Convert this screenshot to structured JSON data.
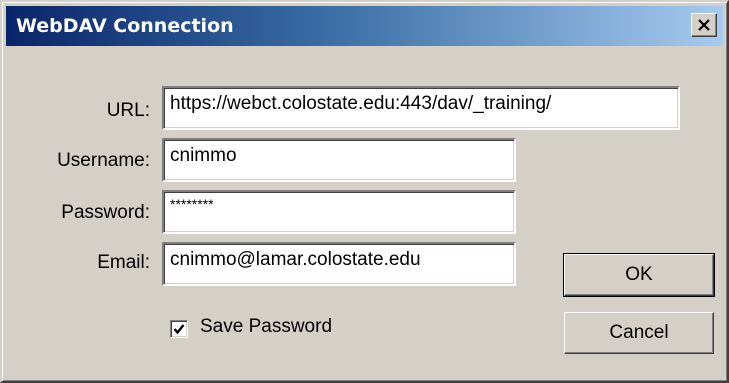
{
  "window": {
    "title": "WebDAV Connection",
    "close_icon": "close-x-icon"
  },
  "form": {
    "url_label": "URL:",
    "url_value": "https://webct.colostate.edu:443/dav/_training/",
    "username_label": "Username:",
    "username_value": "cnimmo",
    "password_label": "Password:",
    "password_value": "********",
    "email_label": "Email:",
    "email_value": "cnimmo@lamar.colostate.edu",
    "save_password_label": "Save Password",
    "save_password_checked": true
  },
  "buttons": {
    "ok_label": "OK",
    "cancel_label": "Cancel"
  },
  "colors": {
    "titlebar_start": "#0a246a",
    "titlebar_end": "#a6caf0",
    "dialog_face": "#d4d0c8"
  }
}
